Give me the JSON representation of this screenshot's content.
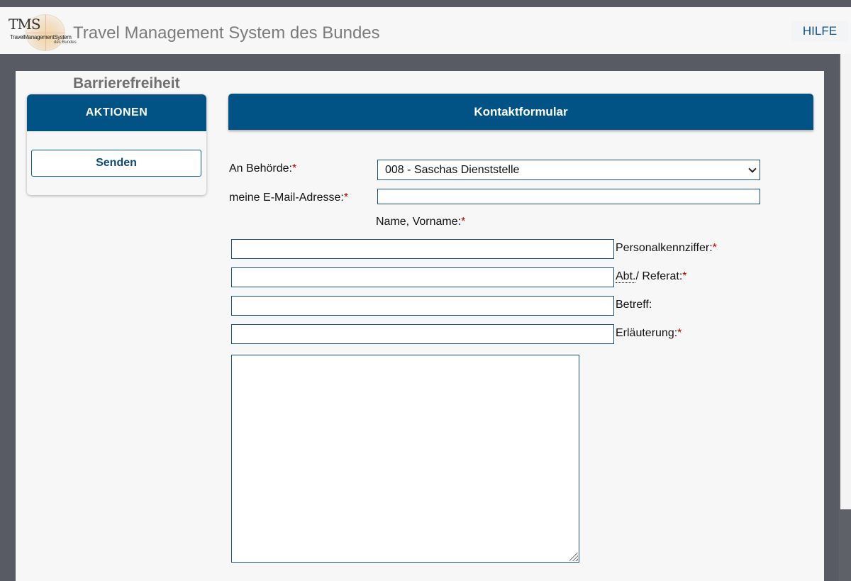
{
  "header": {
    "logo_letters": "TMS",
    "logo_line1": "TravelManagementSystem",
    "logo_line2": "des Bundes",
    "app_title": "Travel Management System des Bundes",
    "help_label": "HILFE"
  },
  "page": {
    "heading": "Barrierefreiheit"
  },
  "actions": {
    "header": "AKTIONEN",
    "send_label": "Senden"
  },
  "form": {
    "title": "Kontaktformular",
    "required_mark": "*",
    "authority": {
      "label": "An Behörde:",
      "value": "008 - Saschas Dienststelle"
    },
    "email": {
      "label": "meine E-Mail-Adresse:",
      "value": ""
    },
    "name": {
      "label": "Name, Vorname:",
      "value": ""
    },
    "personnel_number": {
      "label": "Personalkennziffer:",
      "value": ""
    },
    "department": {
      "abbr": "Abt.",
      "label": "/ Referat:",
      "value": ""
    },
    "subject": {
      "label": "Betreff:",
      "value": ""
    },
    "explanation": {
      "label": "Erläuterung:",
      "value": ""
    }
  },
  "colors": {
    "brand_blue": "#005384",
    "required_red": "#b00000"
  }
}
